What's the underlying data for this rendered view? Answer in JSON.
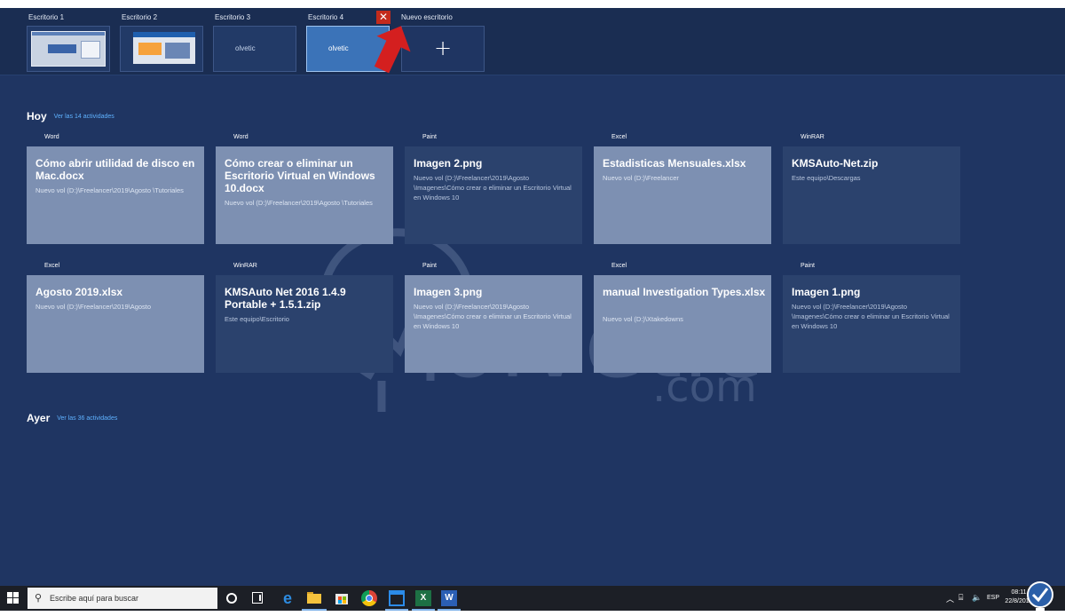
{
  "desktops": [
    {
      "label": "Escritorio 1",
      "active": false
    },
    {
      "label": "Escritorio 2",
      "active": false
    },
    {
      "label": "Escritorio 3",
      "active": false,
      "thumb_text": "olvetic"
    },
    {
      "label": "Escritorio 4",
      "active": true,
      "thumb_text": "olvetic"
    }
  ],
  "new_desktop": {
    "label": "Nuevo escritorio",
    "icon": "plus-icon",
    "symbol": "+"
  },
  "close_symbol": "✕",
  "today": {
    "title": "Hoy",
    "link": "Ver las 14 actividades",
    "cards": [
      {
        "app": "Word",
        "title": "Cómo abrir utilidad de disco en Mac.docx",
        "path": "Nuevo vol (D:)\\Freelancer\\2019\\Agosto \\Tutoriales",
        "style": "light"
      },
      {
        "app": "Word",
        "title": "Cómo crear o eliminar un Escritorio Virtual en Windows 10.docx",
        "path": "Nuevo vol (D:)\\Freelancer\\2019\\Agosto \\Tutoriales",
        "style": "light"
      },
      {
        "app": "Paint",
        "title": "Imagen 2.png",
        "path": "Nuevo vol (D:)\\Freelancer\\2019\\Agosto \\Imagenes\\Cómo crear o eliminar un Escritorio Virtual en Windows 10",
        "style": "dark"
      },
      {
        "app": "Excel",
        "title": "Estadisticas Mensuales.xlsx",
        "path": "Nuevo vol (D:)\\Freelancer",
        "style": "light"
      },
      {
        "app": "WinRAR",
        "title": "KMSAuto-Net.zip",
        "path": "Este equipo\\Descargas",
        "style": "dark"
      },
      {
        "app": "Excel",
        "title": "Agosto  2019.xlsx",
        "path": "Nuevo vol (D:)\\Freelancer\\2019\\Agosto",
        "style": "light"
      },
      {
        "app": "WinRAR",
        "title": "KMSAuto Net 2016 1.4.9 Portable + 1.5.1.zip",
        "path": "Este equipo\\Escritorio",
        "style": "dark"
      },
      {
        "app": "Paint",
        "title": "Imagen 3.png",
        "path": "Nuevo vol (D:)\\Freelancer\\2019\\Agosto \\Imagenes\\Cómo crear o eliminar un Escritorio Virtual en Windows 10",
        "style": "light"
      },
      {
        "app": "Excel",
        "title": "manual Investigation Types.xlsx",
        "path": "Nuevo vol (D:)\\Xtakedowns",
        "style": "light"
      },
      {
        "app": "Paint",
        "title": "Imagen 1.png",
        "path": "Nuevo vol (D:)\\Freelancer\\2019\\Agosto \\Imagenes\\Cómo crear o eliminar un Escritorio Virtual en Windows 10",
        "style": "dark"
      }
    ]
  },
  "yesterday": {
    "title": "Ayer",
    "link": "Ver las 36 actividades"
  },
  "watermark": {
    "text": "olvetic",
    "suffix": ".com"
  },
  "taskbar": {
    "search_placeholder": "Escribe aquí para buscar",
    "excel_letter": "X",
    "word_letter": "W",
    "lang": "ESP",
    "time": "08:11",
    "date": "22/8/2019",
    "notifications": "7"
  },
  "colors": {
    "accent": "#3b73b8",
    "close": "#c42b1c",
    "link": "#5fb2ff"
  }
}
